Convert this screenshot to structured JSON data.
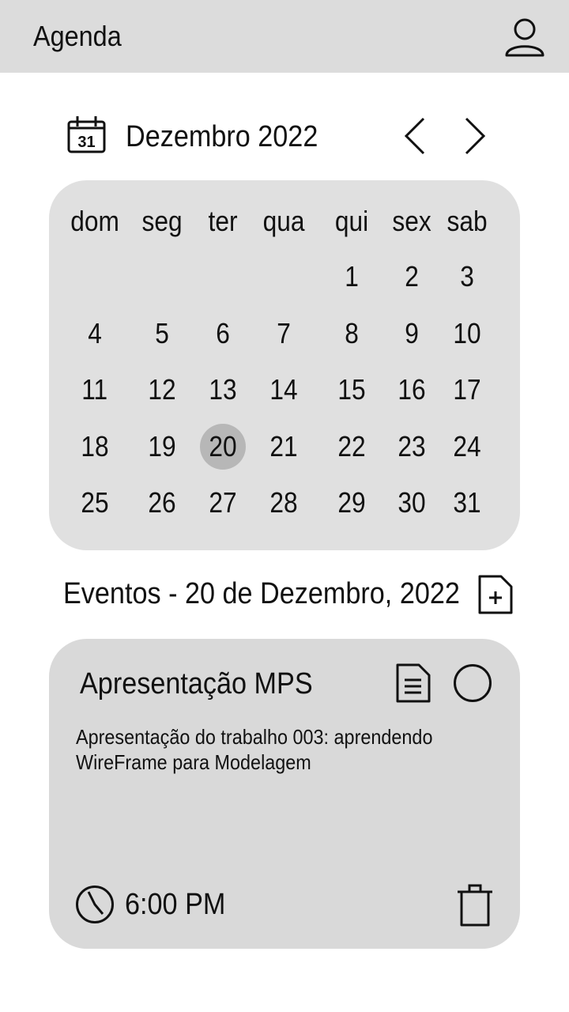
{
  "header": {
    "title": "Agenda",
    "user_icon": "user-icon"
  },
  "month_nav": {
    "calendar_icon_day": "31",
    "label": "Dezembro 2022",
    "prev_icon": "chevron-left-icon",
    "next_icon": "chevron-right-icon"
  },
  "calendar": {
    "weekdays": [
      "dom",
      "seg",
      "ter",
      "qua",
      "qui",
      "sex",
      "sab"
    ],
    "weeks": [
      [
        "",
        "",
        "",
        "",
        "1",
        "2",
        "3"
      ],
      [
        "4",
        "5",
        "6",
        "7",
        "8",
        "9",
        "10"
      ],
      [
        "11",
        "12",
        "13",
        "14",
        "15",
        "16",
        "17"
      ],
      [
        "18",
        "19",
        "20",
        "21",
        "22",
        "23",
        "24"
      ],
      [
        "25",
        "26",
        "27",
        "28",
        "29",
        "30",
        "31"
      ]
    ],
    "selected_day": "20"
  },
  "events": {
    "title": "Eventos - 20 de Dezembro, 2022",
    "add_icon": "add-document-icon",
    "items": [
      {
        "name": "Apresentação MPS",
        "description": "Apresentação do trabalho 003: aprendendo WireFrame para Modelagem",
        "time": "6:00 PM"
      }
    ]
  },
  "colors": {
    "header_bg": "#dcdcdc",
    "calendar_bg": "#e0e0e0",
    "card_bg": "#d9d9d9",
    "selected_day_bg": "#b7b7b7",
    "text": "#111111"
  }
}
